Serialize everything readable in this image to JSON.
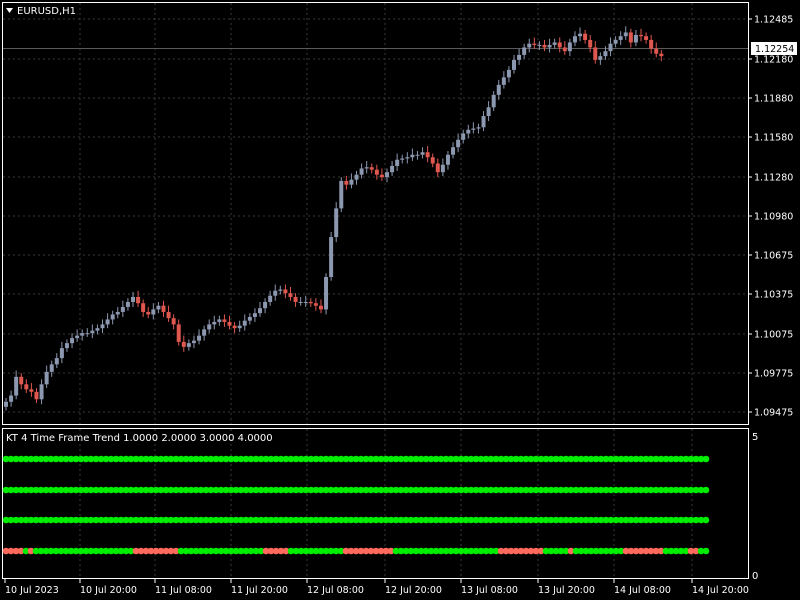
{
  "symbol_label": "EURUSD,H1",
  "current_price": "1.12254",
  "price_axis": [
    "1.12485",
    "1.12180",
    "1.11880",
    "1.11580",
    "1.11280",
    "1.10980",
    "1.10675",
    "1.10375",
    "1.10075",
    "1.09775",
    "1.09475"
  ],
  "time_axis": [
    "10 Jul 2023",
    "10 Jul 20:00",
    "11 Jul 08:00",
    "11 Jul 20:00",
    "12 Jul 08:00",
    "12 Jul 20:00",
    "13 Jul 08:00",
    "13 Jul 20:00",
    "14 Jul 08:00",
    "14 Jul 20:00"
  ],
  "indicator": {
    "label": "KT 4 Time Frame Trend 1.0000 2.0000 3.0000 4.0000",
    "scale_max": "5",
    "scale_min": "0",
    "rows_colors": {
      "row1": "all-green",
      "row2": "all-green",
      "row3": "all-green",
      "row4_red_ranges": [
        [
          0,
          3
        ],
        [
          5,
          5
        ],
        [
          26,
          34
        ],
        [
          52,
          56
        ],
        [
          68,
          77
        ],
        [
          99,
          107
        ],
        [
          113,
          113
        ],
        [
          124,
          131
        ],
        [
          137,
          138
        ]
      ]
    }
  },
  "colors": {
    "background": "#000000",
    "bull_candle": "#8c97b0",
    "bear_candle": "#e0574f",
    "grid": "#3a3a3a",
    "axis_text": "#ffffff",
    "dot_green": "#00ee00",
    "dot_red": "#ff6a5c",
    "price_box_bg": "#ffffff",
    "price_box_text": "#000000"
  },
  "chart_data": {
    "type": "candlestick",
    "title": "EURUSD,H1",
    "y_range": [
      1.0935,
      1.1262
    ],
    "series": [
      {
        "name": "close",
        "values": [
          1.0948,
          1.0953,
          1.0968,
          1.0962,
          1.0958,
          1.0956,
          1.095,
          1.0962,
          1.0972,
          1.0978,
          1.0983,
          1.0991,
          1.0995,
          1.0999,
          1.1001,
          1.1003,
          1.1003,
          1.1005,
          1.1007,
          1.101,
          1.1014,
          1.1018,
          1.102,
          1.1024,
          1.1028,
          1.1032,
          1.1027,
          1.102,
          1.1018,
          1.1022,
          1.1025,
          1.102,
          1.1015,
          1.101,
          1.0996,
          1.0992,
          1.0995,
          1.0997,
          1.1001,
          1.1006,
          1.101,
          1.1012,
          1.1014,
          1.1012,
          1.1009,
          1.1007,
          1.1009,
          1.1013,
          1.1016,
          1.1019,
          1.1023,
          1.1028,
          1.1033,
          1.1037,
          1.1038,
          1.1035,
          1.1032,
          1.1028,
          1.1028,
          1.1028,
          1.1027,
          1.1025,
          1.1022,
          1.1048,
          1.108,
          1.1103,
          1.1125,
          1.1122,
          1.1126,
          1.113,
          1.1135,
          1.1136,
          1.1134,
          1.113,
          1.1128,
          1.1132,
          1.1137,
          1.1142,
          1.1143,
          1.1144,
          1.1146,
          1.1146,
          1.1148,
          1.1144,
          1.1139,
          1.1132,
          1.1138,
          1.1146,
          1.1152,
          1.1158,
          1.1163,
          1.1166,
          1.1167,
          1.1168,
          1.1177,
          1.1184,
          1.1194,
          1.1202,
          1.1208,
          1.1214,
          1.1222,
          1.1226,
          1.1232,
          1.1235,
          1.1234,
          1.1234,
          1.1232,
          1.1234,
          1.1236,
          1.1232,
          1.1229,
          1.1236,
          1.1241,
          1.1243,
          1.1238,
          1.1232,
          1.1222,
          1.1225,
          1.1229,
          1.1235,
          1.1238,
          1.1241,
          1.1244,
          1.1236,
          1.1242,
          1.1241,
          1.1238,
          1.1231,
          1.1227,
          1.1225
        ]
      }
    ]
  }
}
